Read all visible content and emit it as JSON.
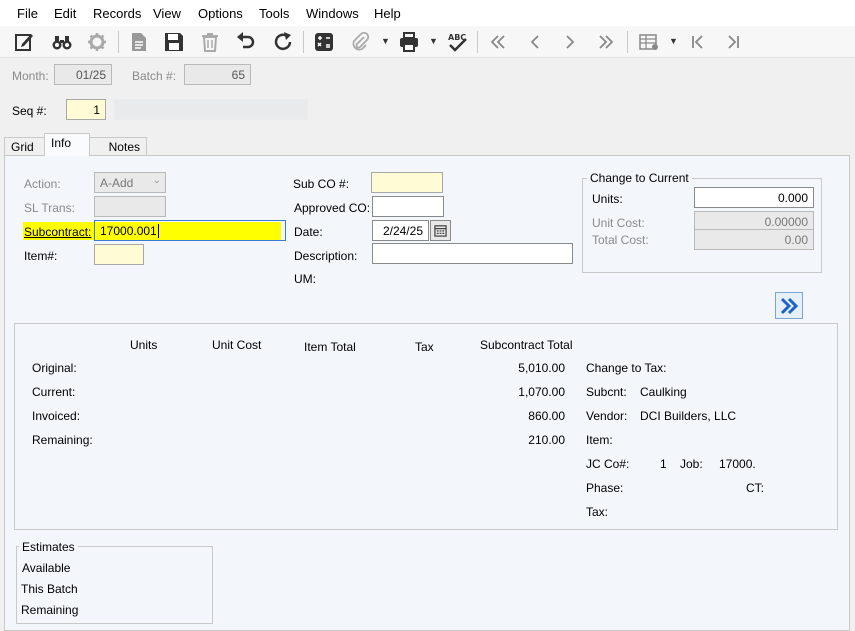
{
  "menu": [
    "File",
    "Edit",
    "Records",
    "View",
    "Options",
    "Tools",
    "Windows",
    "Help"
  ],
  "header": {
    "month_label": "Month:",
    "month_value": "01/25",
    "batch_label": "Batch #:",
    "batch_value": "65",
    "seq_label": "Seq #:",
    "seq_value": "1"
  },
  "tabs": [
    "Grid",
    "Info",
    "Notes"
  ],
  "form": {
    "action_label": "Action:",
    "action_value": "A-Add",
    "sl_trans_label": "SL Trans:",
    "subcontract_label": "Subcontract:",
    "subcontract_value": "17000.001",
    "item_label": "Item#:",
    "sub_co_label": "Sub CO #:",
    "approved_co_label": "Approved CO:",
    "date_label": "Date:",
    "date_value": "2/24/25",
    "description_label": "Description:",
    "um_label": "UM:"
  },
  "change_to_current": {
    "title": "Change to Current",
    "units_label": "Units:",
    "units_value": "0.000",
    "unit_cost_label": "Unit Cost:",
    "unit_cost_value": "0.00000",
    "total_cost_label": "Total Cost:",
    "total_cost_value": "0.00"
  },
  "summary": {
    "col_units": "Units",
    "col_unit_cost": "Unit Cost",
    "col_item_total": "Item Total",
    "col_tax": "Tax",
    "col_subcontract_total": "Subcontract Total",
    "rows": [
      {
        "label": "Original:",
        "total": "5,010.00"
      },
      {
        "label": "Current:",
        "total": "1,070.00"
      },
      {
        "label": "Invoiced:",
        "total": "860.00"
      },
      {
        "label": "Remaining:",
        "total": "210.00"
      }
    ],
    "change_to_tax_label": "Change to Tax:",
    "subcnt_label": "Subcnt:",
    "subcnt_value": "Caulking",
    "vendor_label": "Vendor:",
    "vendor_value": "DCI Builders, LLC",
    "item_label": "Item:",
    "jc_co_label": "JC Co#:",
    "jc_co_value": "1",
    "job_label": "Job:",
    "job_value": "17000.",
    "phase_label": "Phase:",
    "ct_label": "CT:",
    "tax_label": "Tax:"
  },
  "estimates": {
    "title": "Estimates",
    "available": "Available",
    "this_batch": "This Batch",
    "remaining": "Remaining"
  },
  "colors": {
    "highlight": "#ffff00",
    "required_field": "#fffbd5",
    "accent": "#1e64c8"
  }
}
